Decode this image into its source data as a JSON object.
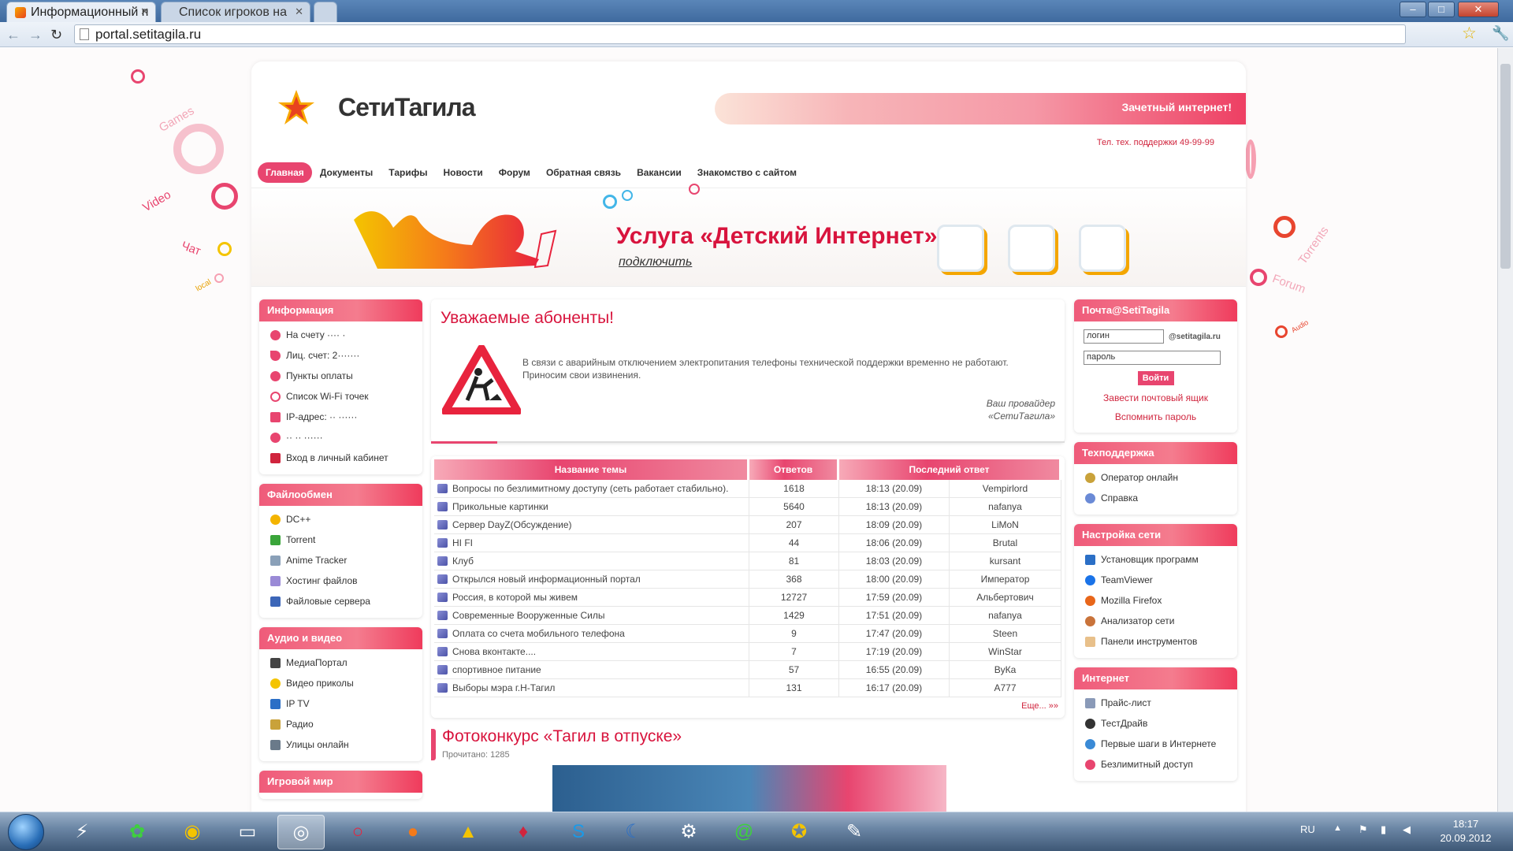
{
  "browser": {
    "tabs": [
      {
        "title": "Информационный п",
        "active": true
      },
      {
        "title": "Список игроков на",
        "active": false
      }
    ],
    "url": "portal.setitagila.ru",
    "window_buttons": {
      "minimize": "–",
      "maximize": "□",
      "close": "✕"
    },
    "back": "←",
    "forward": "→",
    "reload": "↻",
    "star": "☆",
    "wrench": "🔧"
  },
  "decorations": {
    "words": [
      "Games",
      "Video",
      "Чат",
      "local",
      "Torrents",
      "Forum",
      "Audio"
    ]
  },
  "site": {
    "logo_text": "СетиТагила",
    "promo_text": "Зачетный интернет!",
    "phone": "Тел. тех. поддержки 49-99-99",
    "nav": [
      "Главная",
      "Документы",
      "Тарифы",
      "Новости",
      "Форум",
      "Обратная связь",
      "Вакансии",
      "Знакомство с сайтом"
    ],
    "banner": {
      "title": "Услуга «Детский Интернет»",
      "link": "подключить"
    }
  },
  "left": {
    "info": {
      "title": "Информация",
      "items": [
        "На счету ···· ·",
        "Лиц. счет: 2·······",
        "Пункты оплаты",
        "Список Wi-Fi точек",
        "IP-адрес: ·· ······",
        "·· ·· ······",
        "Вход в личный кабинет"
      ]
    },
    "files": {
      "title": "Файлообмен",
      "items": [
        "DC++",
        "Torrent",
        "Anime Tracker",
        "Хостинг файлов",
        "Файловые сервера"
      ]
    },
    "media": {
      "title": "Аудио и видео",
      "items": [
        "МедиаПортал",
        "Видео приколы",
        "IP TV",
        "Радио",
        "Улицы онлайн"
      ]
    },
    "games": {
      "title": "Игровой мир"
    }
  },
  "right": {
    "mail": {
      "title": "Почта@SetiTagila",
      "login_placeholder": "логин",
      "domain": "@setitagila.ru",
      "password_placeholder": "пароль",
      "button": "Войти",
      "links": [
        "Завести почтовый ящик",
        "Вспомнить пароль"
      ]
    },
    "support": {
      "title": "Техподдержка",
      "items": [
        "Оператор онлайн",
        "Справка"
      ]
    },
    "network": {
      "title": "Настройка сети",
      "items": [
        "Установщик программ",
        "TeamViewer",
        "Mozilla Firefox",
        "Анализатор сети",
        "Панели инструментов"
      ]
    },
    "internet": {
      "title": "Интернет",
      "items": [
        "Прайс-лист",
        "ТестДрайв",
        "Первые шаги в Интернете",
        "Безлимитный доступ"
      ]
    }
  },
  "notice": {
    "title": "Уважаемые абоненты!",
    "text": "В связи с аварийным отключением электропитания телефоны технической поддержки временно не работают. Приносим свои извинения.",
    "signature_1": "Ваш провайдер",
    "signature_2": "«СетиТагила»"
  },
  "forum": {
    "headers": [
      "Название темы",
      "Ответов",
      "Последний ответ"
    ],
    "rows": [
      {
        "topic": "Вопросы по безлимитному доступу (сеть работает стабильно).",
        "replies": "1618",
        "time": "18:13 (20.09)",
        "user": "Vempirlord"
      },
      {
        "topic": "Прикольные картинки",
        "replies": "5640",
        "time": "18:13 (20.09)",
        "user": "nafanya"
      },
      {
        "topic": "Сервер DayZ(Обсуждение)",
        "replies": "207",
        "time": "18:09 (20.09)",
        "user": "LiMoN"
      },
      {
        "topic": "HI FI",
        "replies": "44",
        "time": "18:06 (20.09)",
        "user": "Brutal"
      },
      {
        "topic": "Клуб",
        "replies": "81",
        "time": "18:03 (20.09)",
        "user": "kursant"
      },
      {
        "topic": "Открылся новый информационный портал",
        "replies": "368",
        "time": "18:00 (20.09)",
        "user": "Император"
      },
      {
        "topic": "Россия, в которой мы живем",
        "replies": "12727",
        "time": "17:59 (20.09)",
        "user": "Альбертович"
      },
      {
        "topic": "Современные Вооруженные Силы",
        "replies": "1429",
        "time": "17:51 (20.09)",
        "user": "nafanya"
      },
      {
        "topic": "Оплата со счета мобильного телефона",
        "replies": "9",
        "time": "17:47 (20.09)",
        "user": "Steen"
      },
      {
        "topic": "Снова вконтакте....",
        "replies": "7",
        "time": "17:19 (20.09)",
        "user": "WinStar"
      },
      {
        "topic": "спортивное питание",
        "replies": "57",
        "time": "16:55 (20.09)",
        "user": "ВуКа"
      },
      {
        "topic": "Выборы мэра г.Н-Тагил",
        "replies": "131",
        "time": "16:17 (20.09)",
        "user": "A777"
      }
    ],
    "more": "Еще... »»"
  },
  "photo": {
    "title": "Фотоконкурс «Тагил в отпуске»",
    "count": "Прочитано: 1285"
  },
  "taskbar": {
    "lang": "RU",
    "time": "18:17",
    "date": "20.09.2012"
  }
}
